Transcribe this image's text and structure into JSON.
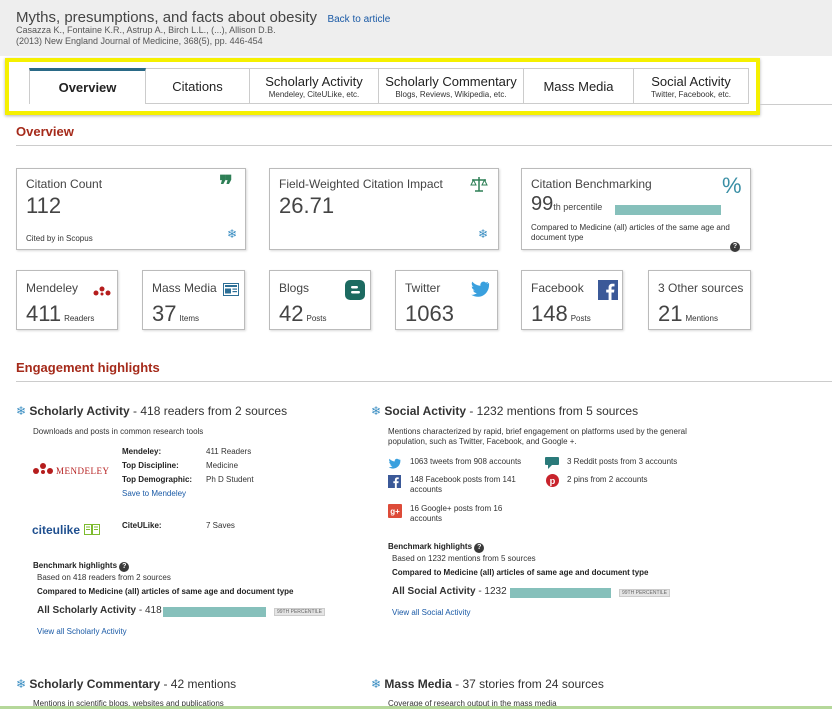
{
  "header": {
    "title": "Myths, presumptions, and facts about obesity",
    "back_link": "Back to article",
    "authors": "Casazza K., Fontaine K.R., Astrup A., Birch L.L., (...), Allison D.B.",
    "citation": "(2013) New England Journal of Medicine, 368(5), pp. 446-454"
  },
  "tabs": [
    {
      "label": "Overview",
      "sub": ""
    },
    {
      "label": "Citations",
      "sub": ""
    },
    {
      "label": "Scholarly Activity",
      "sub": "Mendeley, CiteULike, etc."
    },
    {
      "label": "Scholarly Commentary",
      "sub": "Blogs, Reviews, Wikipedia, etc."
    },
    {
      "label": "Mass Media",
      "sub": ""
    },
    {
      "label": "Social Activity",
      "sub": "Twitter, Facebook, etc."
    }
  ],
  "overview": {
    "heading": "Overview",
    "citation_count": {
      "title": "Citation Count",
      "value": "112",
      "note": "Cited by in Scopus"
    },
    "fwci": {
      "title": "Field-Weighted Citation Impact",
      "value": "26.71"
    },
    "benchmarking": {
      "title": "Citation Benchmarking",
      "value": "99",
      "suffix": "th percentile",
      "percentile": 99,
      "note": "Compared to Medicine (all) articles of the same age and document type",
      "icon_symbol": "%"
    },
    "metrics": [
      {
        "title": "Mendeley",
        "value": "411",
        "unit": "Readers"
      },
      {
        "title": "Mass Media",
        "value": "37",
        "unit": "Items"
      },
      {
        "title": "Blogs",
        "value": "42",
        "unit": "Posts"
      },
      {
        "title": "Twitter",
        "value": "1063",
        "unit": ""
      },
      {
        "title": "Facebook",
        "value": "148",
        "unit": "Posts"
      },
      {
        "title": "3 Other sources",
        "value": "21",
        "unit": "Mentions"
      }
    ]
  },
  "engagement": {
    "heading": "Engagement highlights",
    "scholarly": {
      "title": "Scholarly Activity",
      "summary": "- 418 readers from 2 sources",
      "desc": "Downloads and posts in common research tools",
      "mendeley_logo": "MENDELEY",
      "mendeley_rows": [
        {
          "k": "Mendeley:",
          "v": "411 Readers"
        },
        {
          "k": "Top Discipline:",
          "v": "Medicine"
        },
        {
          "k": "Top Demographic:",
          "v": "Ph D Student"
        }
      ],
      "save_link": "Save to Mendeley",
      "citeulike_logo": "citeulike",
      "citeulike_label": "CiteULike:",
      "citeulike_value": "7 Saves",
      "bench_title": "Benchmark highlights",
      "bench_basis": "Based on 418 readers from 2 sources",
      "bench_compare": "Compared to Medicine (all) articles of same age and document type",
      "bench_row_label": "All Scholarly Activity",
      "bench_row_value": "- 418",
      "bench_badge": "99TH PERCENTILE",
      "bench_percentile": 99,
      "view_all": "View all Scholarly Activity"
    },
    "social": {
      "title": "Social Activity",
      "summary": "- 1232 mentions from 5 sources",
      "desc": "Mentions characterized by rapid, brief engagement on platforms used by the general population, such as Twitter, Facebook, and Google +.",
      "items": [
        {
          "icon": "twitter-icon",
          "text": "1063 tweets from 908 accounts"
        },
        {
          "icon": "reddit-icon",
          "text": "3 Reddit posts from 3 accounts"
        },
        {
          "icon": "facebook-icon",
          "text": "148 Facebook posts from 141 accounts"
        },
        {
          "icon": "pinterest-icon",
          "text": "2 pins from 2 accounts"
        },
        {
          "icon": "google-plus-icon",
          "text": "16 Google+ posts from 16 accounts"
        }
      ],
      "bench_title": "Benchmark highlights",
      "bench_basis": "Based on 1232 mentions from 5 sources",
      "bench_compare": "Compared to Medicine (all) articles of same age and document type",
      "bench_row_label": "All Social Activity",
      "bench_row_value": "- 1232",
      "bench_badge": "99TH PERCENTILE",
      "bench_percentile": 99,
      "view_all": "View all Social Activity"
    },
    "commentary": {
      "title": "Scholarly Commentary",
      "summary": "- 42 mentions",
      "desc": "Mentions in scientific blogs, websites and publications"
    },
    "mass_media": {
      "title": "Mass Media",
      "summary": "- 37 stories from 24 sources",
      "desc": "Coverage of research output in the mass media"
    }
  },
  "colors": {
    "accent_red": "#a52a1a",
    "link": "#1a5aa6",
    "bar": "#86c0bb",
    "highlight": "#f5f000"
  }
}
